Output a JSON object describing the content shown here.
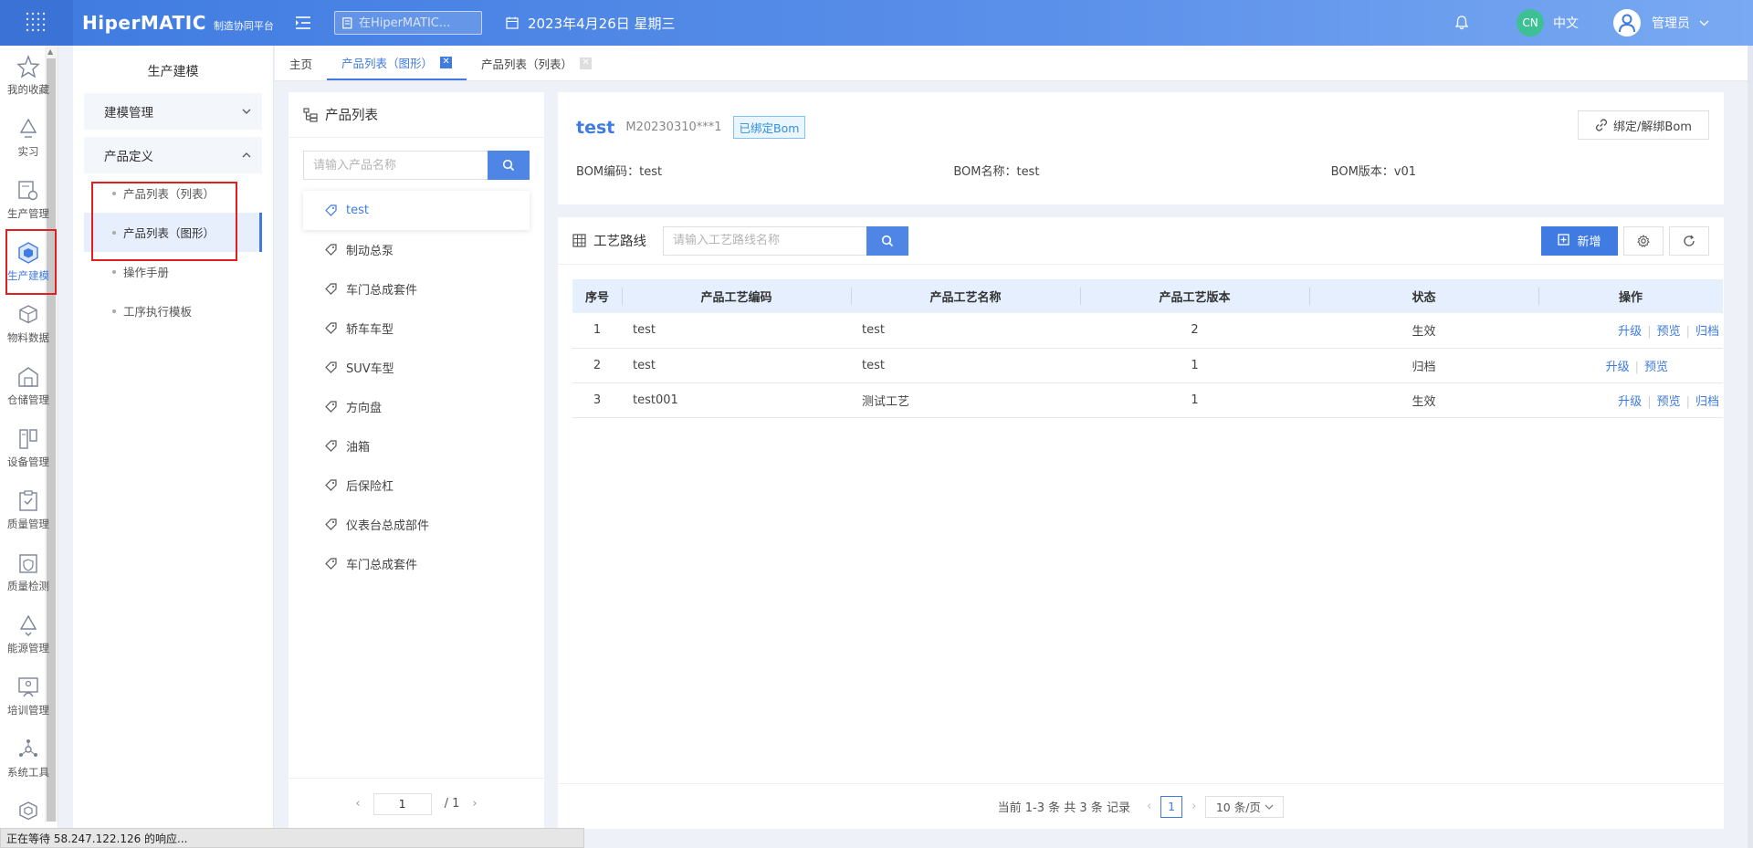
{
  "header": {
    "logo_main": "HiperMATIC",
    "logo_sub": "制造协同平台",
    "search_placeholder": "在HiperMATIC...",
    "date": "2023年4月26日 星期三",
    "lang_badge": "CN",
    "lang_label": "中文",
    "user_name": "管理员"
  },
  "iconnav": {
    "items": [
      {
        "label": "我的收藏",
        "icon": "star-icon"
      },
      {
        "label": "实习",
        "icon": "recycle-icon"
      },
      {
        "label": "生产管理",
        "icon": "production-icon"
      },
      {
        "label": "生产建模",
        "icon": "cube-icon"
      },
      {
        "label": "物料数据",
        "icon": "material-icon"
      },
      {
        "label": "仓储管理",
        "icon": "warehouse-icon"
      },
      {
        "label": "设备管理",
        "icon": "device-icon"
      },
      {
        "label": "质量管理",
        "icon": "quality-icon"
      },
      {
        "label": "质量检测",
        "icon": "inspection-icon"
      },
      {
        "label": "能源管理",
        "icon": "energy-icon"
      },
      {
        "label": "培训管理",
        "icon": "training-icon"
      },
      {
        "label": "系统工具",
        "icon": "system-icon"
      }
    ]
  },
  "sidemenu": {
    "title": "生产建模",
    "group1": "建模管理",
    "group2": "产品定义",
    "sub_items": [
      "产品列表（列表）",
      "产品列表（图形）",
      "操作手册",
      "工序执行模板"
    ]
  },
  "tabs": {
    "home": "主页",
    "tab1": "产品列表（图形）",
    "tab2": "产品列表（列表）"
  },
  "plist": {
    "title": "产品列表",
    "search_placeholder": "请输入产品名称",
    "items": [
      "test",
      "制动总泵",
      "车门总成套件",
      "轿车车型",
      "SUV车型",
      "方向盘",
      "油箱",
      "后保险杠",
      "仪表台总成部件",
      "车门总成套件"
    ],
    "page_current": "1",
    "page_total": "/ 1"
  },
  "detail": {
    "name": "test",
    "code": "M20230310***1",
    "tag": "已绑定Bom",
    "bind_button": "绑定/解绑Bom",
    "bom_code": "BOM编码：test",
    "bom_name": "BOM名称：test",
    "bom_version": "BOM版本：v01"
  },
  "route": {
    "title": "工艺路线",
    "search_placeholder": "请输入工艺路线名称",
    "add_button": "新增",
    "columns": [
      "序号",
      "产品工艺编码",
      "产品工艺名称",
      "产品工艺版本",
      "状态",
      "操作"
    ],
    "rows": [
      {
        "idx": "1",
        "code": "test",
        "name": "test",
        "version": "2",
        "status": "生效",
        "ops": [
          "升级",
          "预览",
          "归档"
        ]
      },
      {
        "idx": "2",
        "code": "test",
        "name": "test",
        "version": "1",
        "status": "归档",
        "ops": [
          "升级",
          "预览"
        ]
      },
      {
        "idx": "3",
        "code": "test001",
        "name": "测试工艺",
        "version": "1",
        "status": "生效",
        "ops": [
          "升级",
          "预览",
          "归档"
        ]
      }
    ],
    "pager_summary": "当前 1-3 条 共 3 条 记录",
    "pager_current": "1",
    "pager_size": "10 条/页"
  },
  "statusbar": {
    "text": "正在等待 58.247.122.126 的响应..."
  },
  "colors": {
    "accent": "#3f7be0",
    "header_start": "#3f7be0",
    "header_end": "#79a9f2",
    "highlight_box": "#e02020"
  }
}
